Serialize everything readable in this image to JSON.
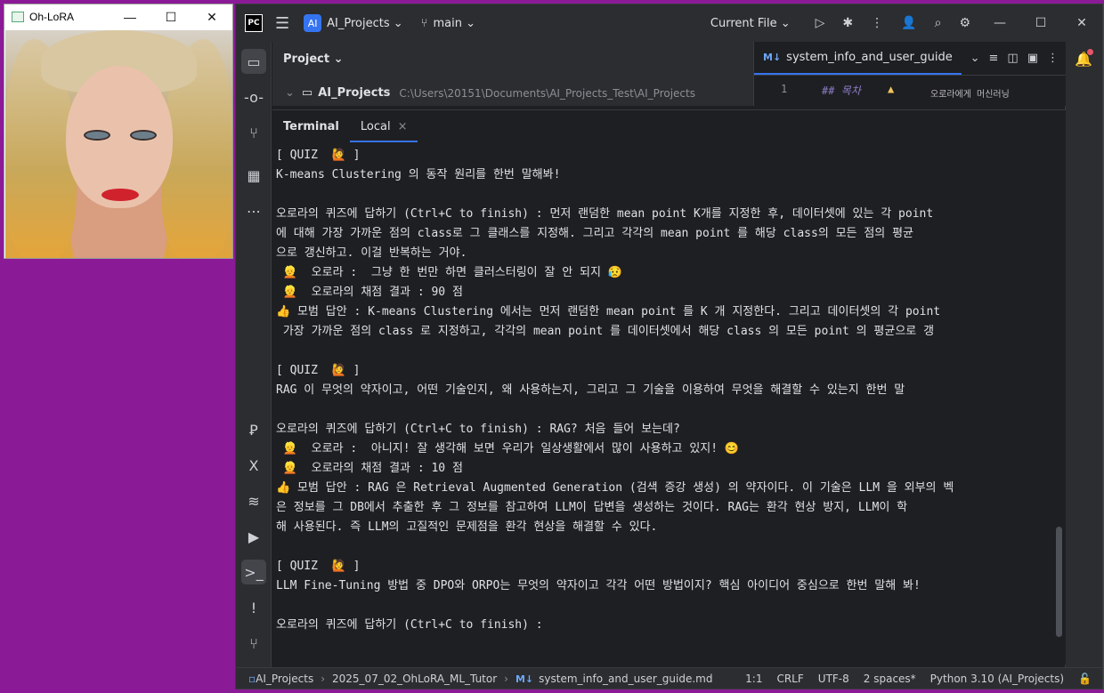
{
  "ohlora_window": {
    "title": "Oh-LoRA"
  },
  "ide": {
    "topbar": {
      "logo": "PC",
      "project_badge": "AI",
      "project_name": "AI_Projects",
      "branch": "main",
      "run_config": "Current File"
    },
    "project_panel": {
      "header": "Project",
      "root_label": "AI_Projects",
      "root_path": "C:\\Users\\20151\\Documents\\AI_Projects_Test\\AI_Projects"
    },
    "editor": {
      "tab_label": "system_info_and_user_guide",
      "line_number": "1",
      "line_code": "## 목차",
      "side_preview": "오로라에게 머신러닝"
    },
    "terminal": {
      "tab_terminal": "Terminal",
      "tab_local": "Local",
      "lines": [
        "[ QUIZ  🙋 ]",
        "K-means Clustering 의 동작 원리를 한번 말해봐!",
        "",
        "오로라의 퀴즈에 답하기 (Ctrl+C to finish) : 먼저 랜덤한 mean point K개를 지정한 후, 데이터셋에 있는 각 point",
        "에 대해 가장 가까운 점의 class로 그 클래스를 지정해. 그리고 각각의 mean point 를 해당 class의 모든 점의 평균",
        "으로 갱신하고. 이걸 반복하는 거야.",
        " 👱  오로라 :  그냥 한 번만 하면 클러스터링이 잘 안 되지 😥",
        " 👱  오로라의 채점 결과 : 90 점",
        "👍 모범 답안 : K-means Clustering 에서는 먼저 랜덤한 mean point 를 K 개 지정한다. 그리고 데이터셋의 각 point",
        " 가장 가까운 점의 class 로 지정하고, 각각의 mean point 를 데이터셋에서 해당 class 의 모든 point 의 평균으로 갱",
        "",
        "[ QUIZ  🙋 ]",
        "RAG 이 무엇의 약자이고, 어떤 기술인지, 왜 사용하는지, 그리고 그 기술을 이용하여 무엇을 해결할 수 있는지 한번 말",
        "",
        "오로라의 퀴즈에 답하기 (Ctrl+C to finish) : RAG? 처음 들어 보는데?",
        " 👱  오로라 :  아니지! 잘 생각해 보면 우리가 일상생활에서 많이 사용하고 있지! 😊",
        " 👱  오로라의 채점 결과 : 10 점",
        "👍 모범 답안 : RAG 은 Retrieval Augmented Generation (검색 증강 생성) 의 약자이다. 이 기술은 LLM 을 외부의 벡",
        "은 정보를 그 DB에서 추출한 후 그 정보를 참고하여 LLM이 답변을 생성하는 것이다. RAG는 환각 현상 방지, LLM이 학",
        "해 사용된다. 즉 LLM의 고질적인 문제점을 환각 현상을 해결할 수 있다.",
        "",
        "[ QUIZ  🙋 ]",
        "LLM Fine-Tuning 방법 중 DPO와 ORPO는 무엇의 약자이고 각각 어떤 방법이지? 핵심 아이디어 중심으로 한번 말해 봐!",
        "",
        "오로라의 퀴즈에 답하기 (Ctrl+C to finish) :"
      ]
    },
    "statusbar": {
      "crumb_project": "AI_Projects",
      "crumb_folder": "2025_07_02_OhLoRA_ML_Tutor",
      "crumb_file": "system_info_and_user_guide.md",
      "position": "1:1",
      "line_sep": "CRLF",
      "encoding": "UTF-8",
      "indent": "2 spaces*",
      "interpreter": "Python 3.10 (AI_Projects)"
    }
  }
}
